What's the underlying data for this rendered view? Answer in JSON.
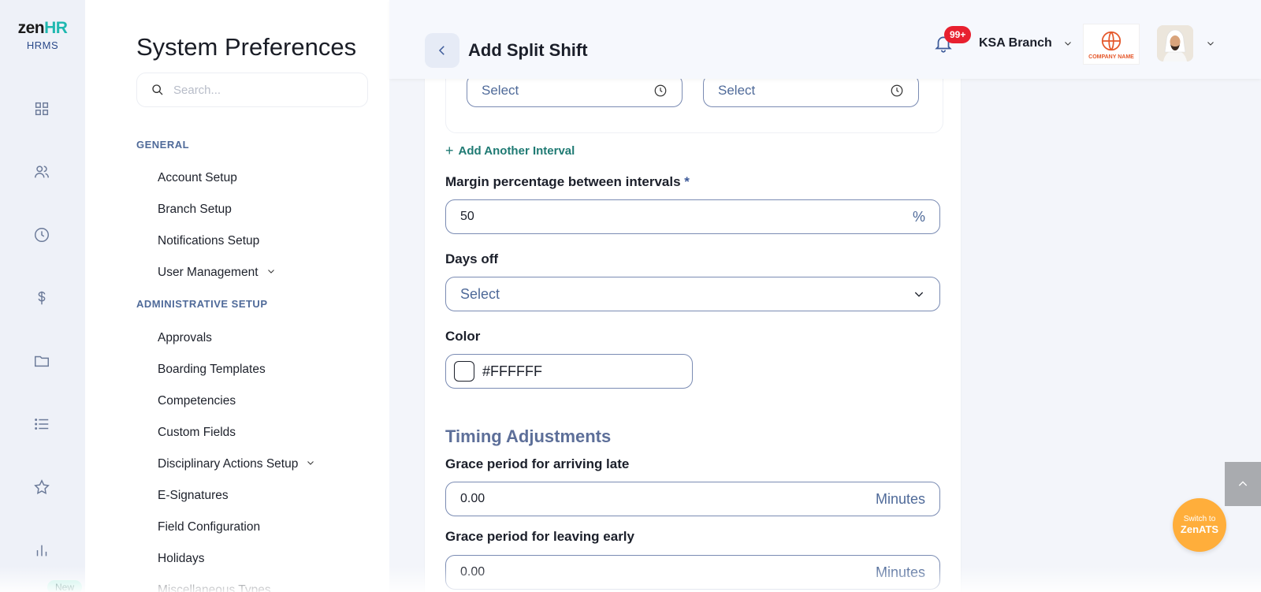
{
  "brand": {
    "name_part1": "zen",
    "name_part2": "HR",
    "sub": "HRMS"
  },
  "rail_icons": [
    "dashboard-icon",
    "people-icon",
    "clock-icon",
    "dollar-icon",
    "folder-icon",
    "list-icon",
    "star-icon",
    "chart-icon"
  ],
  "rail_new_badge": "New",
  "prefs": {
    "title": "System Preferences",
    "search_placeholder": "Search...",
    "general": {
      "heading": "GENERAL",
      "items": [
        "Account Setup",
        "Branch Setup",
        "Notifications Setup",
        "User Management"
      ]
    },
    "admin": {
      "heading": "ADMINISTRATIVE SETUP",
      "items": [
        "Approvals",
        "Boarding Templates",
        "Competencies",
        "Custom Fields",
        "Disciplinary Actions Setup",
        "E-Signatures",
        "Field Configuration",
        "Holidays",
        "Miscellaneous Types"
      ]
    }
  },
  "header": {
    "title": "Add Split Shift",
    "notif_count": "99+",
    "branch": "KSA Branch",
    "company_name": "COMPANY NAME"
  },
  "form": {
    "interval_start_placeholder": "Select",
    "interval_end_placeholder": "Select",
    "add_interval": "Add Another Interval",
    "margin_label": "Margin percentage between intervals",
    "required_mark": "*",
    "margin_value": "50",
    "margin_unit": "%",
    "days_off_label": "Days off",
    "days_off_placeholder": "Select",
    "color_label": "Color",
    "color_value": "#FFFFFF",
    "timing_title": "Timing Adjustments",
    "grace_late_label": "Grace period for arriving late",
    "grace_late_value": "0.00",
    "grace_late_unit": "Minutes",
    "grace_early_label": "Grace period for leaving early",
    "grace_early_value": "0.00",
    "grace_early_unit": "Minutes"
  },
  "floating": {
    "switch_line1": "Switch to",
    "switch_line2": "ZenATS"
  },
  "colors": {
    "accent": "#1f7a73",
    "brand_teal": "#1fb8b0",
    "badge_red": "#e8202f",
    "ats_orange": "#ffae3b"
  }
}
